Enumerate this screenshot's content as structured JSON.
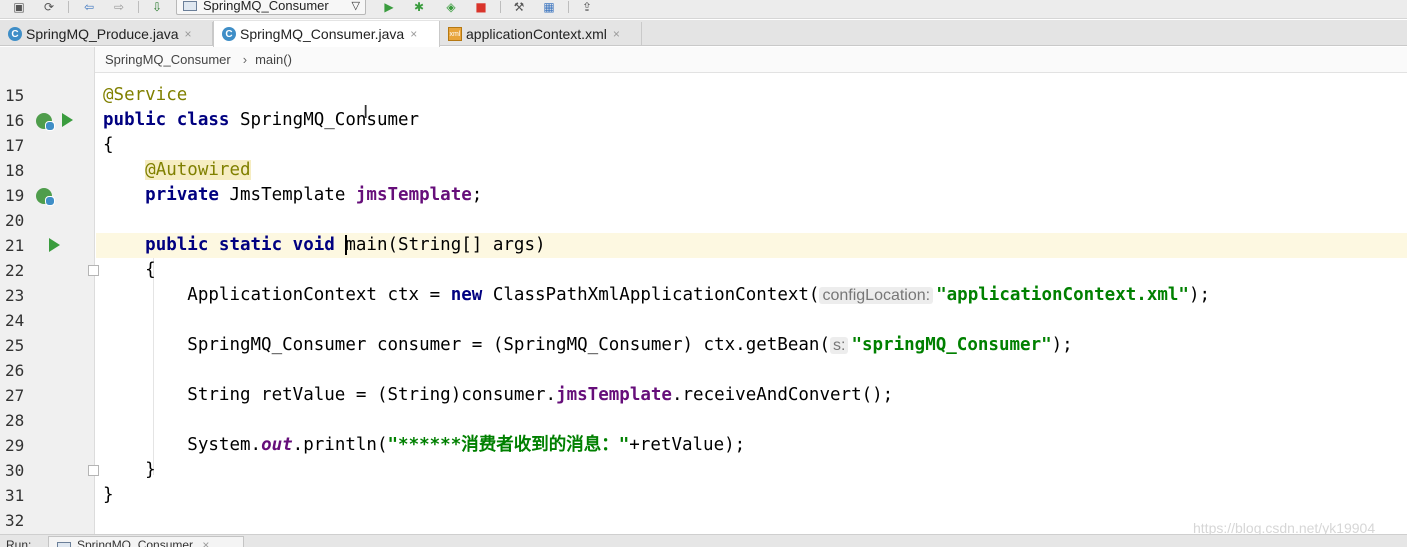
{
  "toolbar": {
    "run_config": "SpringMQ_Consumer",
    "icons": [
      "save-icon",
      "sync-icon",
      "back-icon",
      "forward-icon",
      "build-icon",
      "run-icon",
      "debug-icon",
      "coverage-icon",
      "stop-icon",
      "project-structure-icon",
      "sdk-icon",
      "vcs-icon"
    ]
  },
  "tabs": [
    {
      "label": "SpringMQ_Produce.java",
      "icon": "C",
      "close": "×",
      "active": false
    },
    {
      "label": "SpringMQ_Consumer.java",
      "icon": "C",
      "close": "×",
      "active": true
    },
    {
      "label": "applicationContext.xml",
      "icon": "xml",
      "close": "×",
      "active": false
    }
  ],
  "breadcrumb": {
    "class": "SpringMQ_Consumer",
    "separator": "›",
    "method": "main()"
  },
  "line_numbers": [
    "15",
    "16",
    "17",
    "18",
    "19",
    "20",
    "21",
    "22",
    "23",
    "24",
    "25",
    "26",
    "27",
    "28",
    "29",
    "30",
    "31",
    "32"
  ],
  "code": {
    "l15": "@Service",
    "l16_kw": "public class",
    "l16_name": " SpringMQ_Consumer",
    "l17": "{",
    "l18": "@Autowired",
    "l19_kw": "private",
    "l19_type": " JmsTemplate ",
    "l19_field": "jmsTemplate",
    "l19_end": ";",
    "l21_kw": "public static void",
    "l21_rest": " main(String[] args)",
    "l22": "{",
    "l23_a": "ApplicationContext ctx = ",
    "l23_new": "new",
    "l23_b": " ClassPathXmlApplicationContext(",
    "l23_hint": "configLocation:",
    "l23_str": "\"applicationContext.xml\"",
    "l23_end": ");",
    "l25_a": "SpringMQ_Consumer consumer = (SpringMQ_Consumer) ctx.getBean(",
    "l25_hint": "s:",
    "l25_str": "\"springMQ_Consumer\"",
    "l25_end": ");",
    "l27_a": "String retValue = (String)consumer.",
    "l27_field": "jmsTemplate",
    "l27_end": ".receiveAndConvert();",
    "l29_a": "System.",
    "l29_out": "out",
    "l29_b": ".println(",
    "l29_str": "\"******消费者收到的消息：\"",
    "l29_end": "+retValue);",
    "l30": "}",
    "l31": "}"
  },
  "run_bar": {
    "label": "Run:",
    "tab": "SpringMQ_Consumer",
    "close": "×"
  },
  "watermark": "https://blog.csdn.net/yk19904",
  "colors": {
    "keyword": "#000080",
    "annotation": "#808000",
    "field": "#660e7a",
    "string": "#008000",
    "current_line": "#fdf8e1",
    "run_green": "#3a9c3e"
  }
}
